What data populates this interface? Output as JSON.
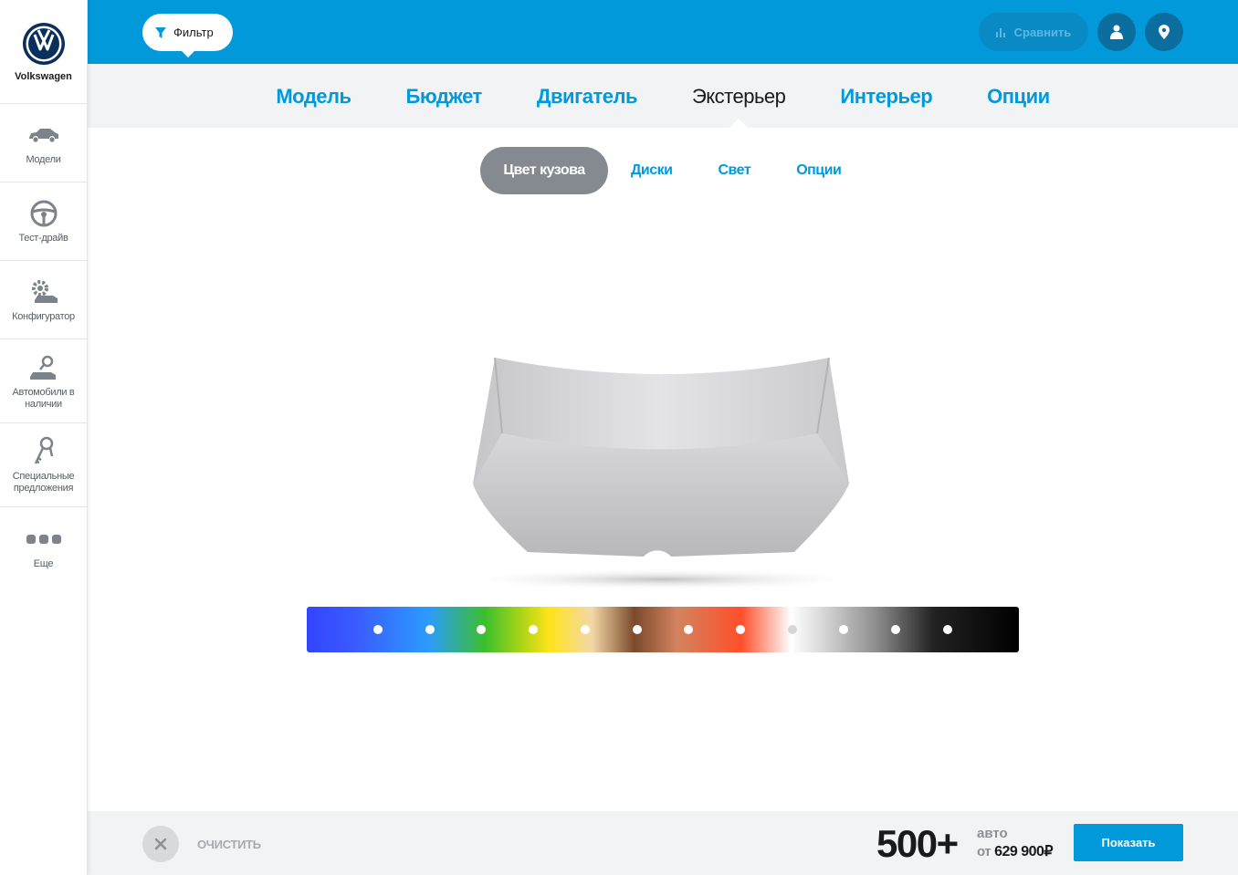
{
  "brand": {
    "name": "Volkswagen",
    "logo_icon": "vw-logo-icon"
  },
  "sidebar": {
    "items": [
      {
        "label": "Модели",
        "icon": "car-icon"
      },
      {
        "label": "Тест-драйв",
        "icon": "steering-wheel-icon"
      },
      {
        "label": "Конфигуратор",
        "icon": "configurator-gear-car-icon"
      },
      {
        "label": "Автомобили в наличии",
        "icon": "car-search-icon"
      },
      {
        "label": "Специальные предложения",
        "icon": "keys-icon"
      },
      {
        "label": "Еще",
        "icon": "more-dots-icon"
      }
    ]
  },
  "topbar": {
    "filter_label": "Фильтр",
    "compare_label": "Сравнить",
    "colors": {
      "bar": "#0199da",
      "round_button": "#0b6e9e"
    }
  },
  "main_tabs": [
    {
      "label": "Модель",
      "active": false
    },
    {
      "label": "Бюджет",
      "active": false
    },
    {
      "label": "Двигатель",
      "active": false
    },
    {
      "label": "Экстерьер",
      "active": true
    },
    {
      "label": "Интерьер",
      "active": false
    },
    {
      "label": "Опции",
      "active": false
    }
  ],
  "sub_tabs": [
    {
      "label": "Цвет кузова",
      "active": true
    },
    {
      "label": "Диски",
      "active": false
    },
    {
      "label": "Свет",
      "active": false
    },
    {
      "label": "Опции",
      "active": false
    }
  ],
  "color_palette": {
    "swatches": [
      {
        "name": "blue",
        "color": "#3a4cff"
      },
      {
        "name": "light-blue",
        "color": "#2b9bff"
      },
      {
        "name": "green",
        "color": "#3bbf2e"
      },
      {
        "name": "yellow",
        "color": "#ffe31a"
      },
      {
        "name": "beige",
        "color": "#f4d8a8"
      },
      {
        "name": "brown",
        "color": "#7b4a2c"
      },
      {
        "name": "orange",
        "color": "#d3835f"
      },
      {
        "name": "red",
        "color": "#ff4f2a"
      },
      {
        "name": "white",
        "color": "#ffffff"
      },
      {
        "name": "silver",
        "color": "#dcdcdc"
      },
      {
        "name": "gray",
        "color": "#8d8d8d"
      },
      {
        "name": "black",
        "color": "#000000"
      }
    ]
  },
  "bottombar": {
    "clear_label": "ОЧИСТИТЬ",
    "count": "500+",
    "count_unit": "авто",
    "price_prefix": "от",
    "price": "629 900₽",
    "show_label": "Показать"
  }
}
